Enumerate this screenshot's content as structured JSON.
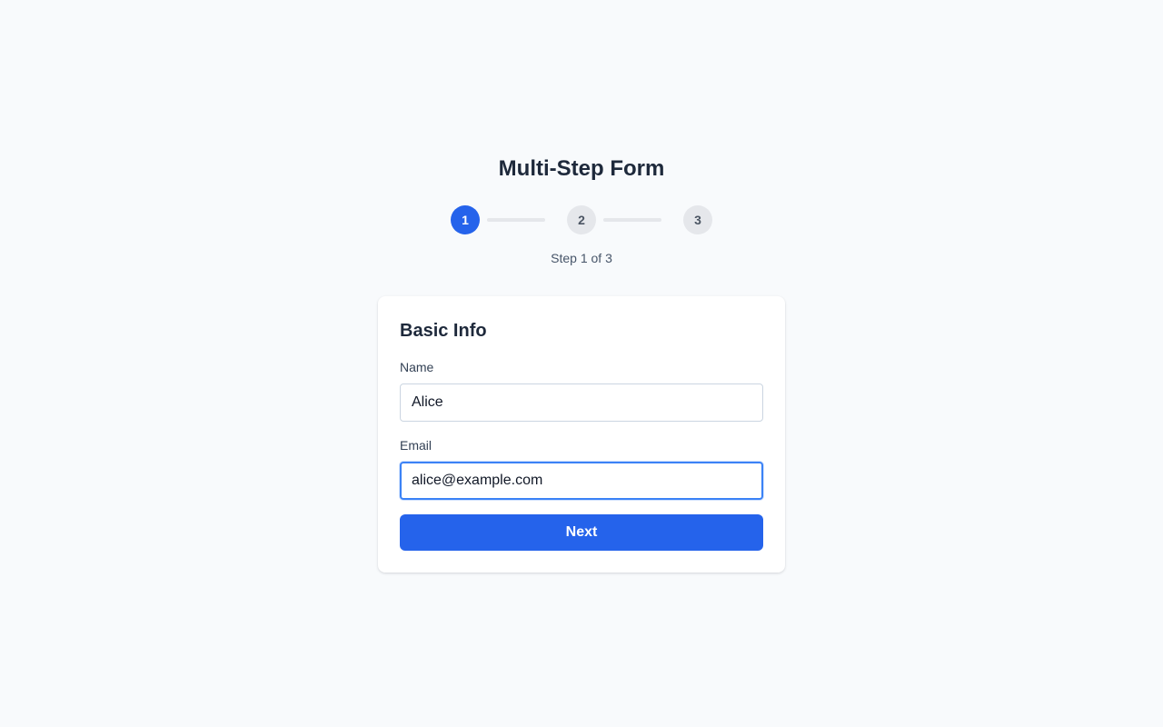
{
  "form": {
    "title": "Multi-Step Form",
    "steps": [
      {
        "number": "1",
        "state": "active"
      },
      {
        "number": "2",
        "state": "inactive"
      },
      {
        "number": "3",
        "state": "inactive"
      }
    ],
    "progress_text": "Step 1 of 3"
  },
  "card": {
    "title": "Basic Info",
    "fields": {
      "name": {
        "label": "Name",
        "value": "Alice"
      },
      "email": {
        "label": "Email",
        "value": "alice@example.com"
      }
    },
    "next_label": "Next"
  },
  "colors": {
    "accent": "#2563eb",
    "focus_ring": "#3b82f6",
    "inactive_step": "#e5e7eb",
    "background": "#f8fafc"
  }
}
